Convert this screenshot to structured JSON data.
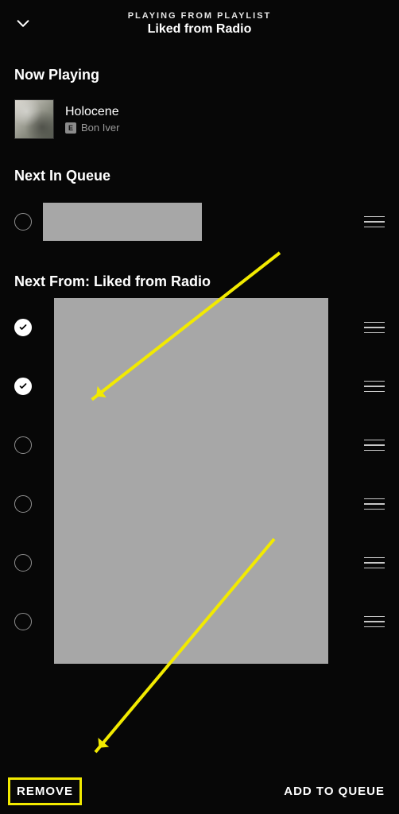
{
  "header": {
    "context": "PLAYING FROM PLAYLIST",
    "playlist": "Liked from Radio"
  },
  "sections": {
    "now_playing": "Now Playing",
    "next_in_queue": "Next In Queue",
    "next_from": "Next From: Liked from Radio"
  },
  "now_playing": {
    "title": "Holocene",
    "artist": "Bon Iver",
    "explicit": "E"
  },
  "next_from_items": [
    {
      "selected": true
    },
    {
      "selected": true
    },
    {
      "selected": false
    },
    {
      "selected": false
    },
    {
      "selected": false
    },
    {
      "selected": false
    }
  ],
  "footer": {
    "remove": "REMOVE",
    "add": "ADD TO QUEUE"
  }
}
